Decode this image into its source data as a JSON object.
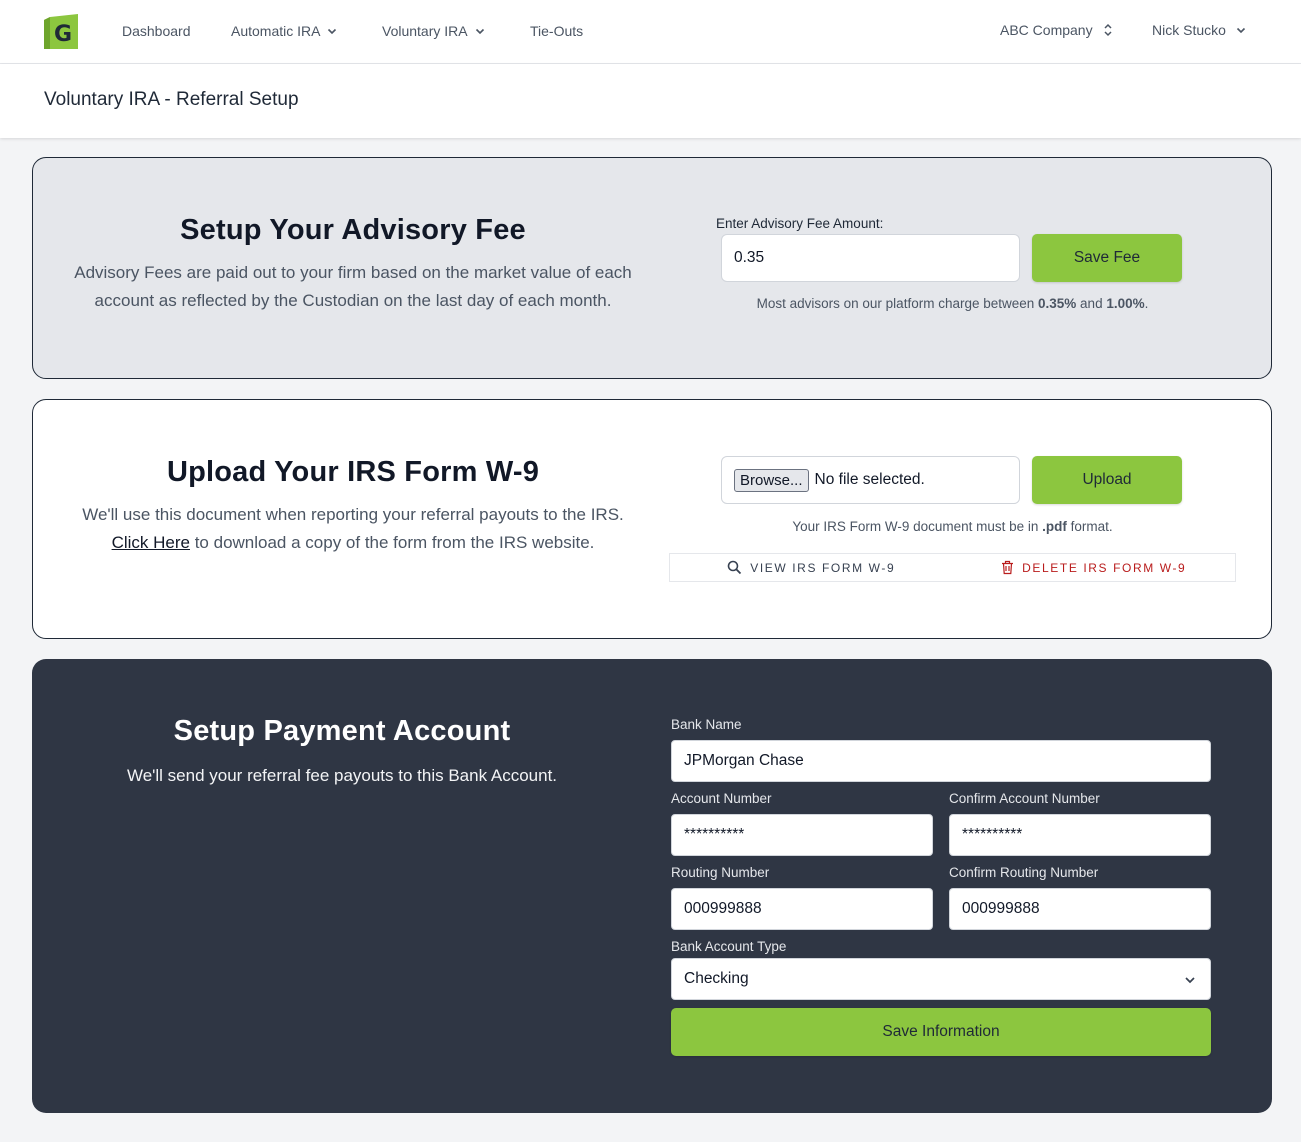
{
  "nav": {
    "logo_letter": "G",
    "items": [
      {
        "label": "Dashboard"
      },
      {
        "label": "Automatic IRA"
      },
      {
        "label": "Voluntary IRA"
      },
      {
        "label": "Tie-Outs"
      }
    ],
    "company": "ABC Company",
    "user": "Nick Stucko"
  },
  "page": {
    "title": "Voluntary IRA - Referral Setup"
  },
  "fee_card": {
    "title": "Setup Your Advisory Fee",
    "desc_line1": "Advisory Fees are paid out to your firm based on the market value of each",
    "desc_line2": "account as reflected by the Custodian on the last day of each month.",
    "input_label": "Enter Advisory Fee Amount:",
    "input_value": "0.35",
    "button": "Save Fee",
    "hint_pre": "Most advisors on our platform charge between ",
    "hint_low": "0.35%",
    "hint_mid": " and ",
    "hint_high": "1.00%",
    "hint_post": "."
  },
  "w9_card": {
    "title": "Upload Your IRS Form W-9",
    "desc_line1": "We'll use this document when reporting your referral payouts to the IRS.",
    "link": "Click Here",
    "desc_line2_rest": " to download a copy of the form from the IRS website.",
    "browse": "Browse...",
    "file_status": "No file selected.",
    "button": "Upload",
    "hint_pre": "Your IRS Form W-9 document must be in ",
    "hint_fmt": ".pdf",
    "hint_post": " format.",
    "view_action": "VIEW IRS FORM W-9",
    "delete_action": "DELETE IRS FORM W-9"
  },
  "pay_card": {
    "title": "Setup Payment Account",
    "desc": "We'll send your referral fee payouts to this Bank Account.",
    "bank_name_label": "Bank Name",
    "bank_name_value": "JPMorgan Chase",
    "account_label": "Account Number",
    "account_value": "**********",
    "confirm_account_label": "Confirm Account Number",
    "confirm_account_value": "**********",
    "routing_label": "Routing Number",
    "routing_value": "000999888",
    "confirm_routing_label": "Confirm Routing Number",
    "confirm_routing_value": "000999888",
    "type_label": "Bank Account Type",
    "type_value": "Checking",
    "button": "Save Information"
  },
  "colors": {
    "accent_green": "#8cc63f",
    "dark_panel": "#2f3644",
    "delete_red": "#b91c1c"
  },
  "icons": [
    "logo-icon",
    "chevron-down-icon",
    "chevron-updown-icon",
    "search-icon",
    "trash-icon"
  ]
}
